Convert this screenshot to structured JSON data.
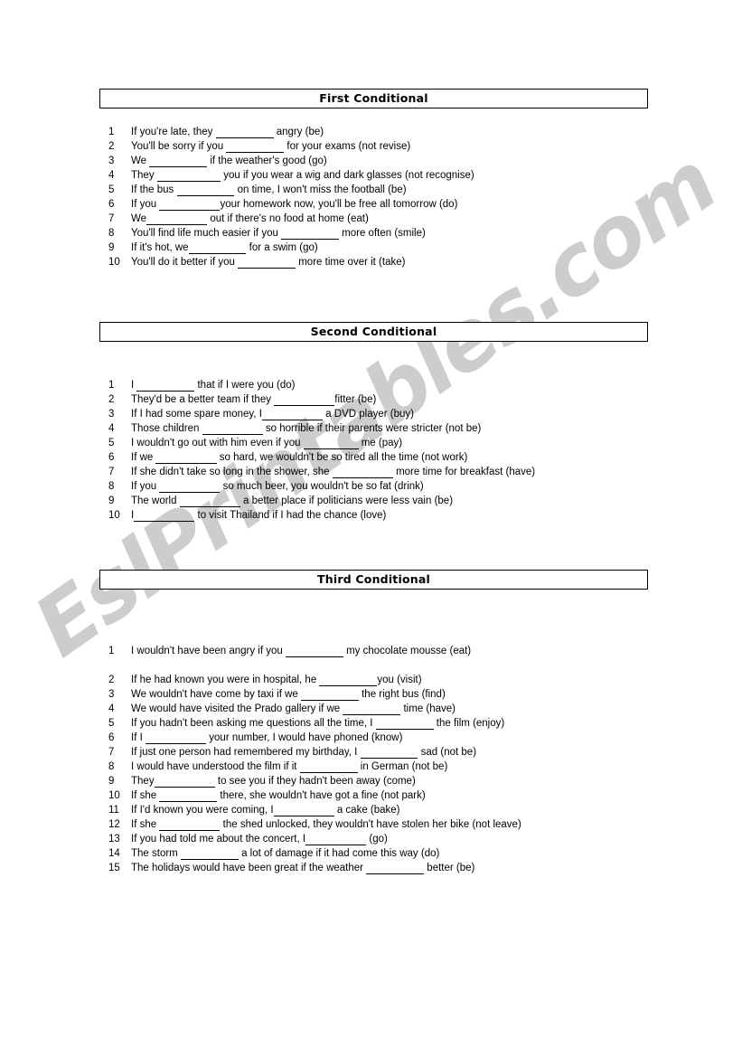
{
  "watermark": {
    "text": "EslPrintables.com",
    "color": "#cdcdcd"
  },
  "worksheet": {
    "sections": [
      {
        "id": "first-conditional",
        "title": "First Conditional",
        "items": [
          {
            "num": "1",
            "pre": "If you're late, they ",
            "blank": "                    ",
            "post": " angry (be)"
          },
          {
            "num": "2",
            "pre": "You'll be sorry if you ",
            "blank": "                    ",
            "post": " for your exams (not revise)"
          },
          {
            "num": "3",
            "pre": "We ",
            "blank": "                    ",
            "post": " if the weather's good (go)"
          },
          {
            "num": "4",
            "pre": "They ",
            "blank": "                      ",
            "post": " you if you wear a wig and dark glasses (not recognise)"
          },
          {
            "num": "5",
            "pre": "If the bus ",
            "blank": "                    ",
            "post": " on time, I won't miss the football (be)"
          },
          {
            "num": "6",
            "pre": "If you ",
            "blank": "                     ",
            "post": "your homework now, you'll be free all tomorrow (do)"
          },
          {
            "num": "7",
            "pre": "We",
            "blank": "                     ",
            "post": " out if there's no food at home (eat)"
          },
          {
            "num": "8",
            "pre": "You'll find life much easier if you ",
            "blank": "                    ",
            "post": " more often (smile)"
          },
          {
            "num": "9",
            "pre": "If it's hot, we",
            "blank": "                    ",
            "post": " for a swim (go)"
          },
          {
            "num": "10",
            "pre": "You'll do it better if you ",
            "blank": "                    ",
            "post": " more time over it (take)"
          }
        ]
      },
      {
        "id": "second-conditional",
        "title": "Second Conditional",
        "items": [
          {
            "num": "1",
            "pre": "I ",
            "blank": "                    ",
            "post": " that if I were you (do)"
          },
          {
            "num": "2",
            "pre": "They'd be a better team if they ",
            "blank": "                     ",
            "post": "fitter (be)"
          },
          {
            "num": "3",
            "pre": "If I had some spare money, I",
            "blank": "                     ",
            "post": " a DVD player (buy)"
          },
          {
            "num": "4",
            "pre": "Those children ",
            "blank": "                     ",
            "post": " so horrible if their parents were stricter (not be)"
          },
          {
            "num": "5",
            "pre": "I wouldn't go out with him even if you ",
            "blank": "                   ",
            "post": " me (pay)"
          },
          {
            "num": "6",
            "pre": "If we ",
            "blank": "                     ",
            "post": " so hard, we wouldn't be so tired all the time (not work)"
          },
          {
            "num": "7",
            "pre": "If she didn't take so long in the shower, she ",
            "blank": "                     ",
            "post": " more time for breakfast (have)"
          },
          {
            "num": "8",
            "pre": "If you ",
            "blank": "                     ",
            "post": " so much beer, you wouldn't be so fat (drink)"
          },
          {
            "num": "9",
            "pre": "The world ",
            "blank": "                     ",
            "post": " a better place if politicians were less vain (be)"
          },
          {
            "num": "10",
            "pre": "I",
            "blank": "                     ",
            "post": " to visit Thailand if I had the chance (love)"
          }
        ]
      },
      {
        "id": "third-conditional",
        "title": "Third Conditional",
        "items": [
          {
            "num": "1",
            "pre": "I wouldn't have been angry if you ",
            "blank": "                    ",
            "post": " my chocolate mousse (eat)"
          },
          {
            "num": "2",
            "pre": "If he had known you were in hospital, he ",
            "blank": "                    ",
            "post": "you (visit)"
          },
          {
            "num": "3",
            "pre": "We wouldn't have come by taxi if we ",
            "blank": "                    ",
            "post": " the right bus (find)"
          },
          {
            "num": "4",
            "pre": "We would have visited the Prado gallery if we ",
            "blank": "                    ",
            "post": " time (have)"
          },
          {
            "num": "5",
            "pre": "If you hadn't been asking me questions all the time, I ",
            "blank": "                    ",
            "post": " the film (enjoy)"
          },
          {
            "num": "6",
            "pre": "If I ",
            "blank": "                     ",
            "post": " your number, I would have phoned (know)"
          },
          {
            "num": "7",
            "pre": "If just one person had remembered my birthday, I ",
            "blank": "                    ",
            "post": " sad (not be)"
          },
          {
            "num": "8",
            "pre": "I would have understood the film if it ",
            "blank": "                    ",
            "post": " in German (not be)"
          },
          {
            "num": "9",
            "pre": "They",
            "blank": "                     ",
            "post": " to see you if they hadn't been away (come)"
          },
          {
            "num": "10",
            "pre": "If she ",
            "blank": "                    ",
            "post": " there, she wouldn't have got a fine (not park)"
          },
          {
            "num": "11",
            "pre": "If I'd known you were coming, I",
            "blank": "                     ",
            "post": " a cake (bake)"
          },
          {
            "num": "12",
            "pre": "If she ",
            "blank": "                     ",
            "post": " the shed unlocked, they wouldn't have stolen her bike (not leave)"
          },
          {
            "num": "13",
            "pre": "If you had told me about the concert, I",
            "blank": "                     ",
            "post": " (go)"
          },
          {
            "num": "14",
            "pre": "The storm ",
            "blank": "                    ",
            "post": " a lot of damage if it had come this way (do)"
          },
          {
            "num": "15",
            "pre": "The holidays would have been great if the weather ",
            "blank": "                    ",
            "post": " better (be)"
          }
        ]
      }
    ]
  }
}
